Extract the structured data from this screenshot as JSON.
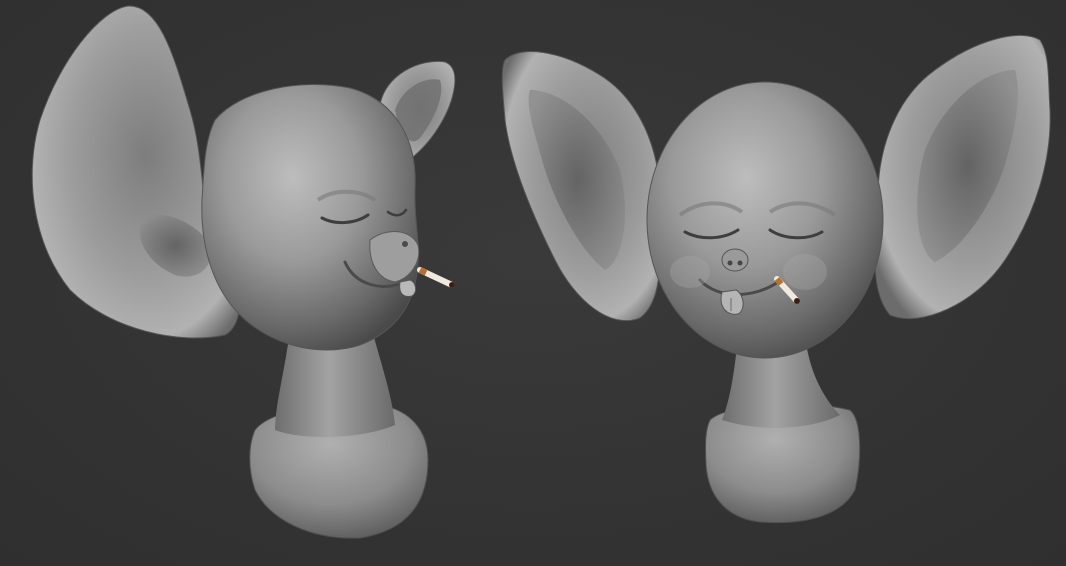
{
  "colors": {
    "background": "#343434",
    "clay_light": "#b5b5b5",
    "clay_mid": "#8a8a8a",
    "clay_dark": "#4a4a4a",
    "cigarette": "#efe9df",
    "cigarette_filter": "#b8702f",
    "ember": "#3a1e14"
  },
  "views": [
    {
      "name": "three-quarter-view"
    },
    {
      "name": "front-view"
    }
  ]
}
